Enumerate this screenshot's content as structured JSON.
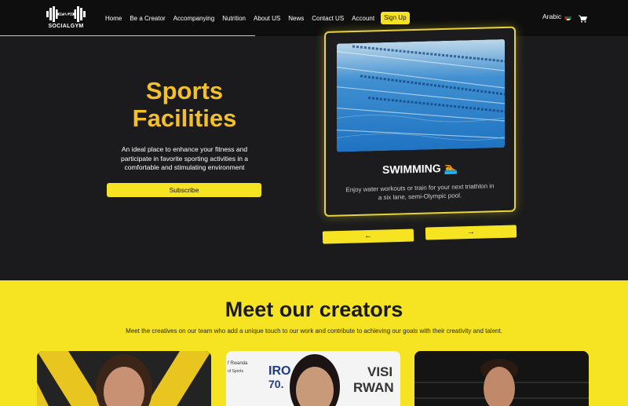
{
  "brand": {
    "name": "SOCIALGYM"
  },
  "nav": {
    "links": [
      "Home",
      "Be a Creator",
      "Accompanying",
      "Nutrition",
      "About US",
      "News",
      "Contact US",
      "Account"
    ],
    "signup_label": "Sign Up",
    "language_label": "Arabic"
  },
  "hero": {
    "title_line1": "Sports",
    "title_line2": "Facilities",
    "description": "An ideal place to enhance your fitness and participate in favorite sporting activities in a comfortable and stimulating environment",
    "subscribe_label": "Subscribe"
  },
  "facility_card": {
    "title": "SWIMMING 🏊",
    "description": "Enjoy water workouts or train for your next triathlon in a six lane, semi-Olympic pool."
  },
  "carousel": {
    "prev_label": "←",
    "next_label": "→"
  },
  "creators": {
    "title": "Meet our creators",
    "subtitle": "Meet the creatives on our team who add a unique touch to our work and contribute to achieving our goals with their creativity and talent.",
    "photo2_text1": "IRO",
    "photo2_text2": "70.",
    "photo2_text3": "VISI",
    "photo2_text4": "RWAN",
    "photo2_text5": "f Rwanda",
    "photo2_text6": "of Sports"
  },
  "colors": {
    "accent": "#f6e321",
    "title_gold": "#f3c02a",
    "background": "#1b1b1d"
  },
  "icons": {
    "flag": "uae-flag-icon",
    "cart": "cart-icon",
    "logo": "dumbbell-logo-icon"
  }
}
